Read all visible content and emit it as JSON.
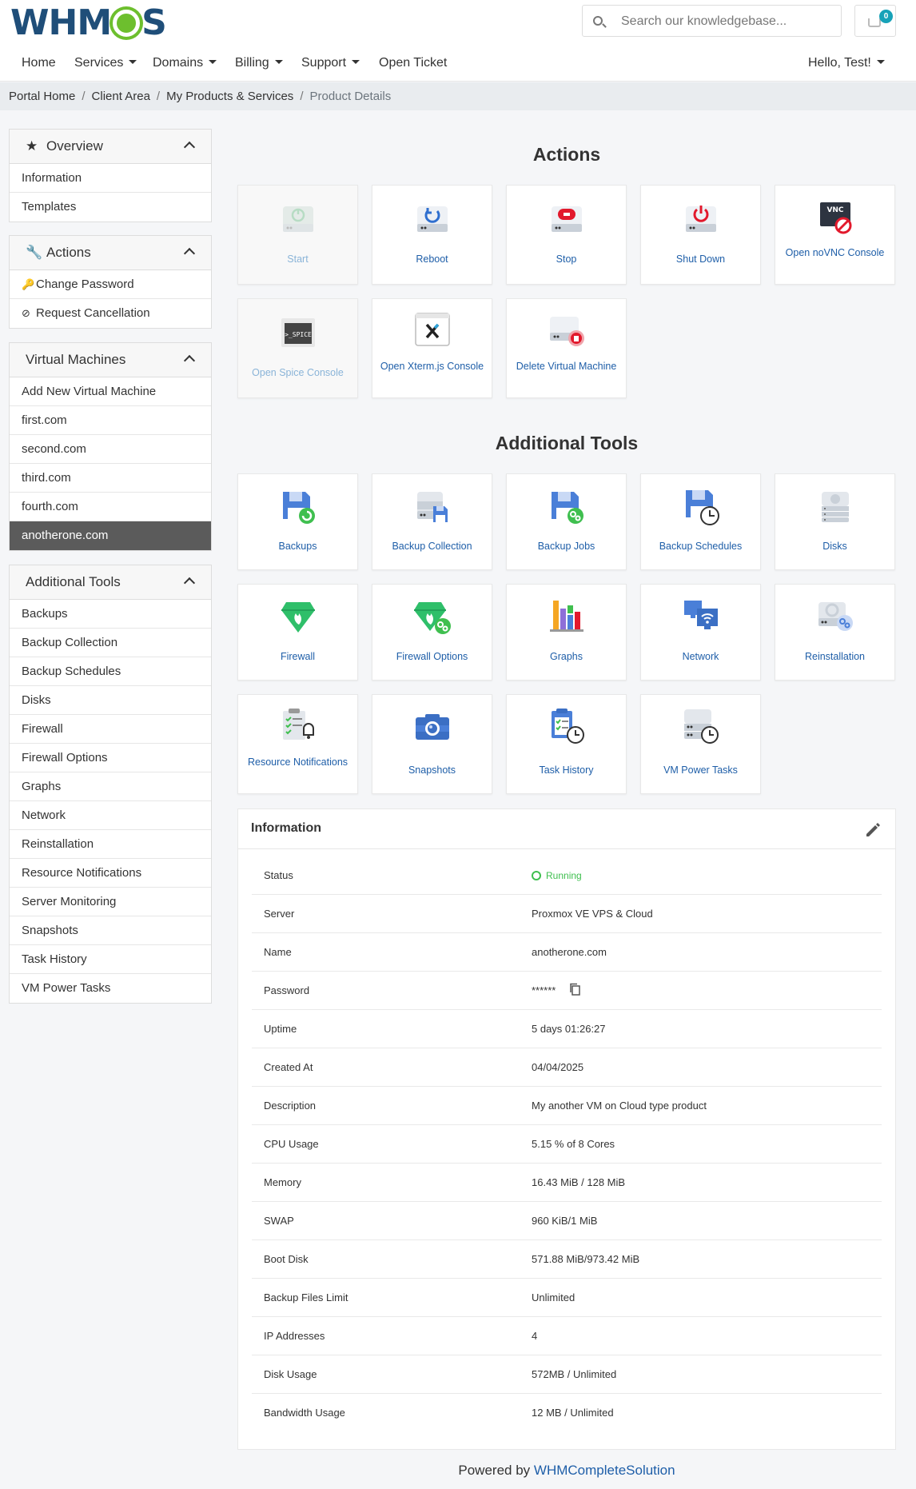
{
  "header": {
    "logo_text": "WHMCS",
    "search_placeholder": "Search our knowledgebase...",
    "cart_count": "0",
    "nav": [
      {
        "label": "Home",
        "has_caret": false
      },
      {
        "label": "Services",
        "has_caret": true
      },
      {
        "label": "Domains",
        "has_caret": true
      },
      {
        "label": "Billing",
        "has_caret": true
      },
      {
        "label": "Support",
        "has_caret": true
      },
      {
        "label": "Open Ticket",
        "has_caret": false
      }
    ],
    "user_label": "Hello, Test!"
  },
  "breadcrumb": [
    "Portal Home",
    "Client Area",
    "My Products & Services",
    "Product Details"
  ],
  "sidebar": {
    "overview": {
      "title": "Overview",
      "items": [
        "Information",
        "Templates"
      ]
    },
    "actions": {
      "title": "Actions",
      "items": [
        "Change Password",
        "Request Cancellation"
      ]
    },
    "virtual_machines": {
      "title": "Virtual Machines",
      "items": [
        "Add New Virtual Machine",
        "first.com",
        "second.com",
        "third.com",
        "fourth.com",
        "anotherone.com"
      ],
      "active": "anotherone.com"
    },
    "additional_tools": {
      "title": "Additional Tools",
      "items": [
        "Backups",
        "Backup Collection",
        "Backup Schedules",
        "Disks",
        "Firewall",
        "Firewall Options",
        "Graphs",
        "Network",
        "Reinstallation",
        "Resource Notifications",
        "Server Monitoring",
        "Snapshots",
        "Task History",
        "VM Power Tasks"
      ]
    }
  },
  "actions": {
    "title": "Actions",
    "tiles": [
      {
        "label": "Start",
        "icon": "start-icon",
        "enabled": false
      },
      {
        "label": "Reboot",
        "icon": "reboot-icon",
        "enabled": true
      },
      {
        "label": "Stop",
        "icon": "stop-icon",
        "enabled": true
      },
      {
        "label": "Shut Down",
        "icon": "shutdown-icon",
        "enabled": true
      },
      {
        "label": "Open noVNC Console",
        "icon": "vnc-console-icon",
        "enabled": true
      },
      {
        "label": "Open Spice Console",
        "icon": "spice-console-icon",
        "enabled": false
      },
      {
        "label": "Open Xterm.js Console",
        "icon": "xterm-console-icon",
        "enabled": true
      },
      {
        "label": "Delete Virtual Machine",
        "icon": "delete-vm-icon",
        "enabled": true
      }
    ]
  },
  "tools": {
    "title": "Additional Tools",
    "tiles": [
      {
        "label": "Backups",
        "icon": "backups-icon"
      },
      {
        "label": "Backup Collection",
        "icon": "backup-collection-icon"
      },
      {
        "label": "Backup Jobs",
        "icon": "backup-jobs-icon"
      },
      {
        "label": "Backup Schedules",
        "icon": "backup-schedules-icon"
      },
      {
        "label": "Disks",
        "icon": "disks-icon"
      },
      {
        "label": "Firewall",
        "icon": "firewall-icon"
      },
      {
        "label": "Firewall Options",
        "icon": "firewall-options-icon"
      },
      {
        "label": "Graphs",
        "icon": "graphs-icon"
      },
      {
        "label": "Network",
        "icon": "network-icon"
      },
      {
        "label": "Reinstallation",
        "icon": "reinstallation-icon"
      },
      {
        "label": "Resource Notifications",
        "icon": "resource-notifications-icon"
      },
      {
        "label": "Snapshots",
        "icon": "snapshots-icon"
      },
      {
        "label": "Task History",
        "icon": "task-history-icon"
      },
      {
        "label": "VM Power Tasks",
        "icon": "vm-power-tasks-icon"
      }
    ]
  },
  "information": {
    "title": "Information",
    "rows": [
      {
        "key": "Status",
        "value": "Running"
      },
      {
        "key": "Server",
        "value": "Proxmox VE VPS & Cloud"
      },
      {
        "key": "Name",
        "value": "anotherone.com"
      },
      {
        "key": "Password",
        "value": "******"
      },
      {
        "key": "Uptime",
        "value": "5 days 01:26:27"
      },
      {
        "key": "Created At",
        "value": "04/04/2025"
      },
      {
        "key": "Description",
        "value": "My another VM on Cloud type product"
      },
      {
        "key": "CPU Usage",
        "value": "5.15 % of 8 Cores"
      },
      {
        "key": "Memory",
        "value": "16.43 MiB / 128 MiB"
      },
      {
        "key": "SWAP",
        "value": "960 KiB/1 MiB"
      },
      {
        "key": "Boot Disk",
        "value": "571.88 MiB/973.42 MiB"
      },
      {
        "key": "Backup Files Limit",
        "value": "Unlimited"
      },
      {
        "key": "IP Addresses",
        "value": "4"
      },
      {
        "key": "Disk Usage",
        "value": "572MB / Unlimited"
      },
      {
        "key": "Bandwidth Usage",
        "value": "12 MB / Unlimited"
      }
    ]
  },
  "footer": {
    "prefix": "Powered by",
    "link": "WHMCompleteSolution"
  },
  "colors": {
    "link": "#1e5ea8",
    "status_running": "#3fbf4f",
    "sidebar_active": "#5b5b5b",
    "logo_blue": "#1f4e79",
    "logo_green": "#6dbf2e"
  }
}
